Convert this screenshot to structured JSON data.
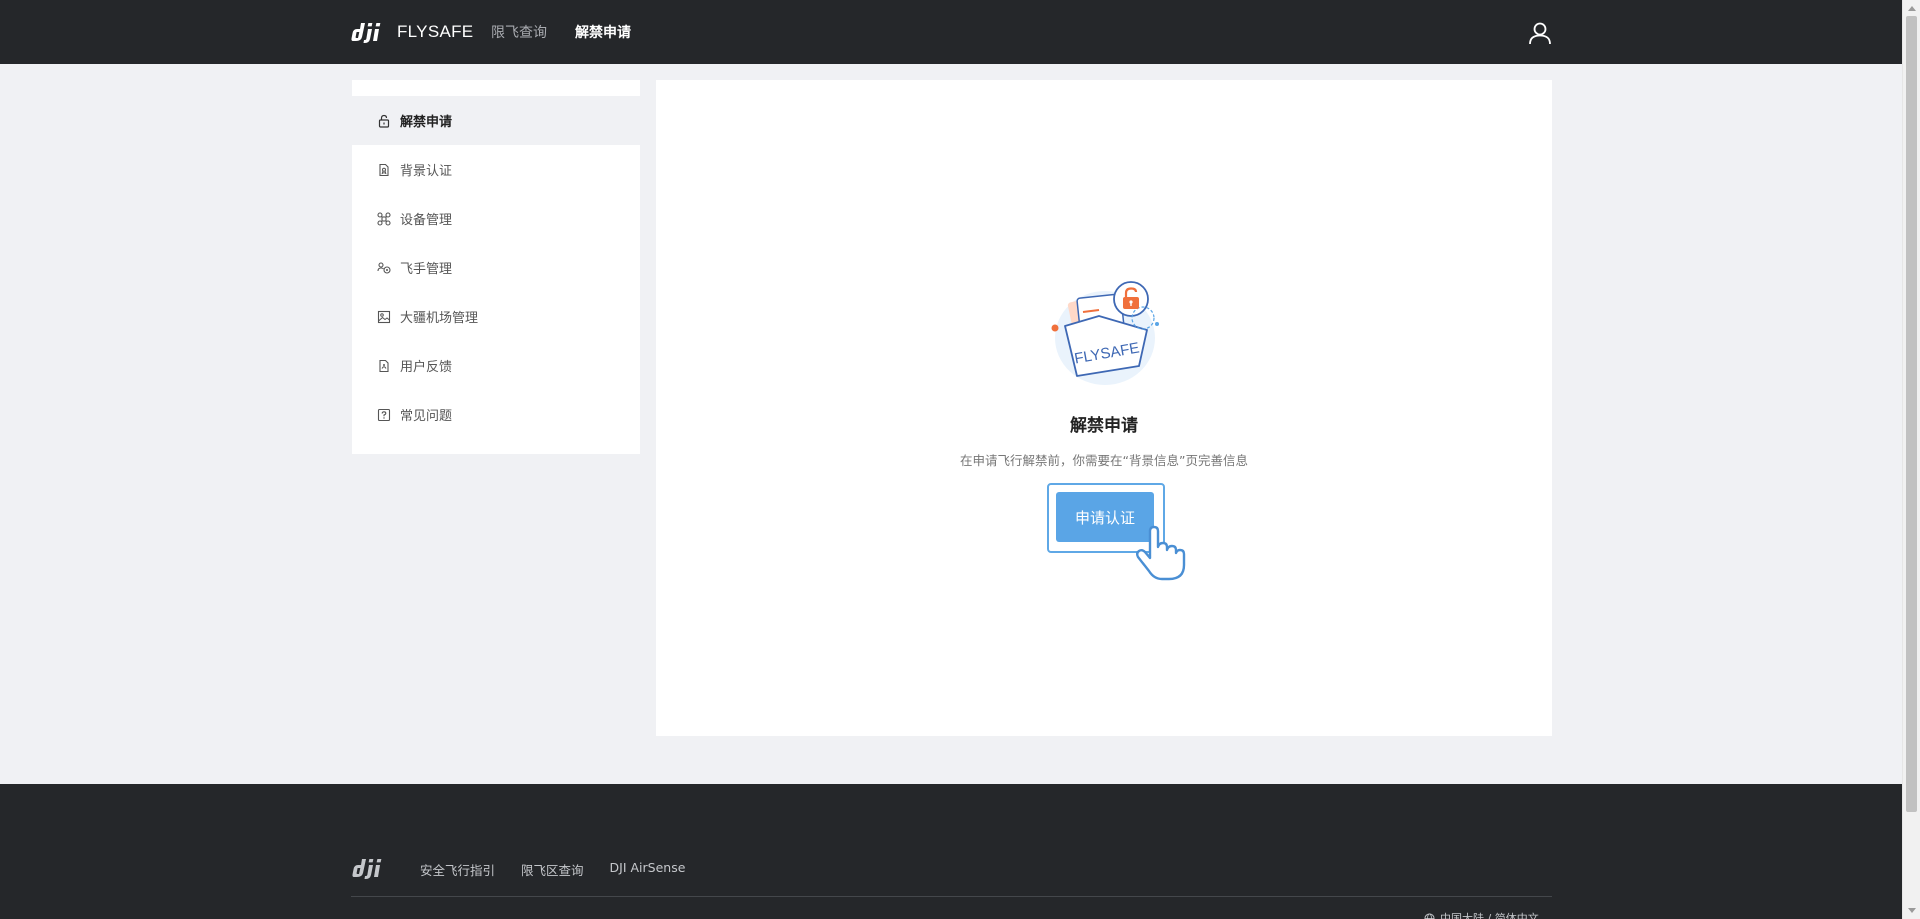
{
  "header": {
    "brand_text": "FLYSAFE",
    "nav": [
      {
        "label": "限飞查询",
        "active": false
      },
      {
        "label": "解禁申请",
        "active": true
      }
    ]
  },
  "sidebar": {
    "items": [
      {
        "label": "解禁申请",
        "icon": "lock-icon",
        "active": true
      },
      {
        "label": "背景认证",
        "icon": "document-icon",
        "active": false
      },
      {
        "label": "设备管理",
        "icon": "drone-icon",
        "active": false
      },
      {
        "label": "飞手管理",
        "icon": "pilot-icon",
        "active": false
      },
      {
        "label": "大疆机场管理",
        "icon": "image-icon",
        "active": false
      },
      {
        "label": "用户反馈",
        "icon": "feedback-icon",
        "active": false
      },
      {
        "label": "常见问题",
        "icon": "help-icon",
        "active": false
      }
    ]
  },
  "main": {
    "illustration_label": "FLYSAFE",
    "title": "解禁申请",
    "description": "在申请飞行解禁前，你需要在“背景信息”页完善信息",
    "apply_button": "申请认证"
  },
  "footer": {
    "links": [
      "安全飞行指引",
      "限飞区查询",
      "DJI AirSense"
    ],
    "region": "中国大陆 / 简体中文"
  },
  "colors": {
    "header_bg": "#25272a",
    "page_bg": "#f0f1f4",
    "accent_blue": "#5aa5e6",
    "lock_orange": "#f0703c"
  }
}
